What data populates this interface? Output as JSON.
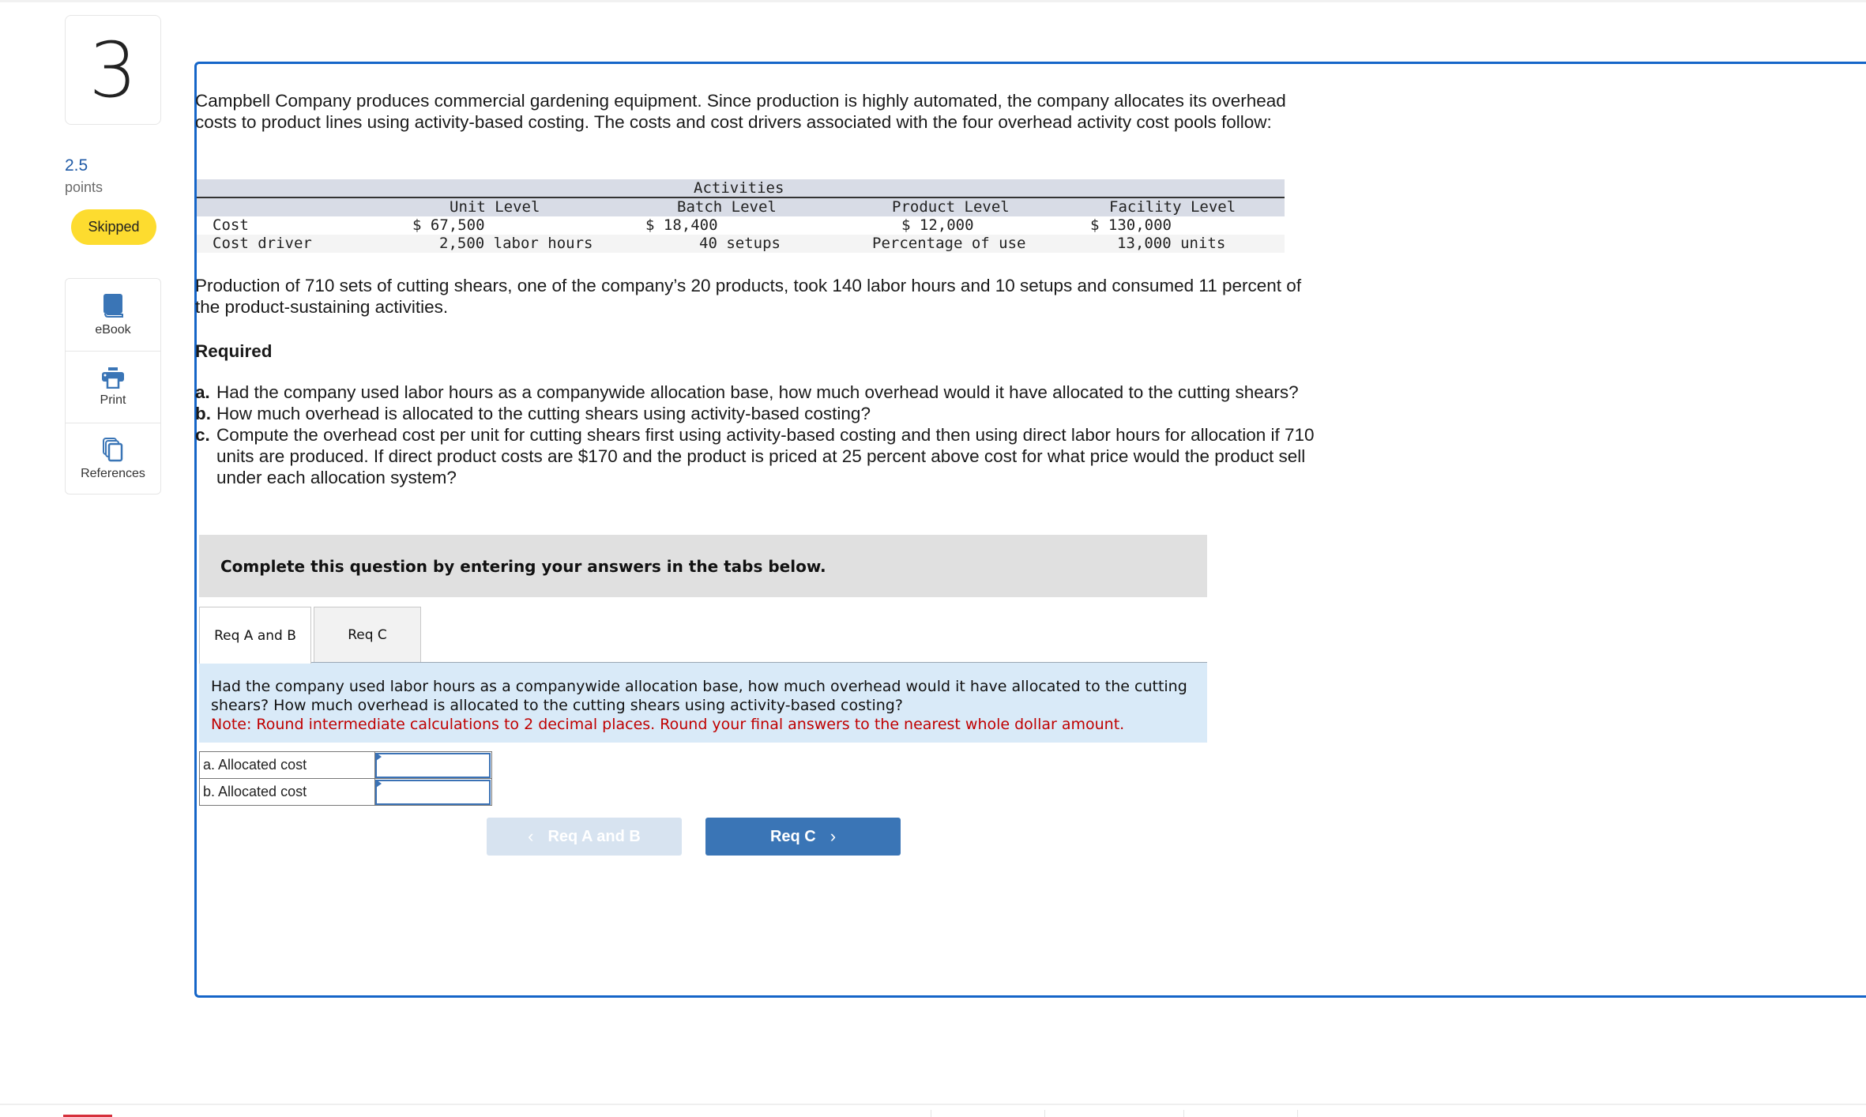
{
  "question": {
    "number": "3",
    "points_value": "2.5",
    "points_label": "points",
    "status": "Skipped"
  },
  "tools": [
    {
      "label": "eBook",
      "icon": "book-icon"
    },
    {
      "label": "Print",
      "icon": "printer-icon"
    },
    {
      "label": "References",
      "icon": "documents-icon"
    }
  ],
  "problem": {
    "intro": "Campbell Company produces commercial gardening equipment. Since production is highly automated, the company allocates its overhead costs to product lines using activity-based costing. The costs and cost drivers associated with the four overhead activity cost pools follow:",
    "table": {
      "group_header": "Activities",
      "columns": [
        "Unit Level",
        "Batch Level",
        "Product Level",
        "Facility Level"
      ],
      "rows": [
        {
          "label": "Cost",
          "cells": [
            "$ 67,500",
            "$ 18,400",
            "$ 12,000",
            "$ 130,000"
          ]
        },
        {
          "label": "Cost driver",
          "cells": [
            "2,500 labor hours",
            "40 setups",
            "Percentage of use",
            "13,000 units"
          ]
        }
      ]
    },
    "production_text": "Production of 710 sets of cutting shears, one of the company’s 20 products, took 140 labor hours and 10 setups and consumed 11 percent of the product-sustaining activities.",
    "required_title": "Required",
    "requirements": [
      {
        "letter": "a.",
        "text": "Had the company used labor hours as a companywide allocation base, how much overhead would it have allocated to the cutting shears?"
      },
      {
        "letter": "b.",
        "text": "How much overhead is allocated to the cutting shears using activity-based costing?"
      },
      {
        "letter": "c.",
        "text": "Compute the overhead cost per unit for cutting shears first using activity-based costing and then using direct labor hours for allocation if 710 units are produced. If direct product costs are $170 and the product is priced at 25 percent above cost for what price would the product sell under each allocation system?"
      }
    ]
  },
  "instructions": "Complete this question by entering your answers in the tabs below.",
  "tabs": [
    {
      "label": "Req A and B",
      "active": true
    },
    {
      "label": "Req C",
      "active": false
    }
  ],
  "active_tab": {
    "question": "Had the company used labor hours as a companywide allocation base, how much overhead would it have allocated to the cutting shears? How much overhead is allocated to the cutting shears using activity-based costing?",
    "note": "Note: Round intermediate calculations to 2 decimal places. Round your final answers to the nearest whole dollar amount.",
    "answers": [
      {
        "label": "a. Allocated cost",
        "value": ""
      },
      {
        "label": "b. Allocated cost",
        "value": ""
      }
    ]
  },
  "navigation": {
    "prev_label": "Req A and B",
    "next_label": "Req C",
    "prev_enabled": false
  },
  "colors": {
    "frame_blue": "#1565c8",
    "skipped_yellow": "#fddc2f",
    "nav_primary": "#3a75b6",
    "note_red": "#c00000"
  }
}
